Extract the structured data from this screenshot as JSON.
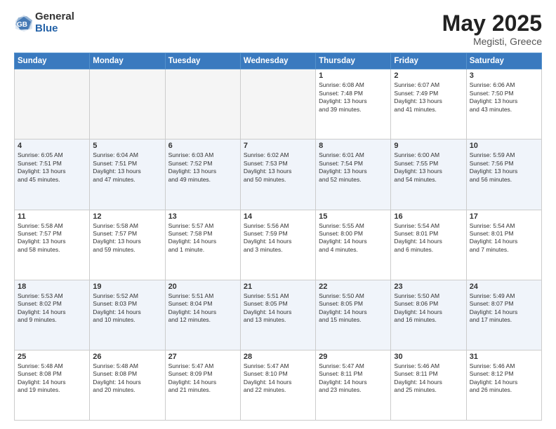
{
  "logo": {
    "general": "General",
    "blue": "Blue"
  },
  "title": {
    "month_year": "May 2025",
    "location": "Megisti, Greece"
  },
  "days_of_week": [
    "Sunday",
    "Monday",
    "Tuesday",
    "Wednesday",
    "Thursday",
    "Friday",
    "Saturday"
  ],
  "weeks": [
    [
      {
        "day": "",
        "info": ""
      },
      {
        "day": "",
        "info": ""
      },
      {
        "day": "",
        "info": ""
      },
      {
        "day": "",
        "info": ""
      },
      {
        "day": "1",
        "info": "Sunrise: 6:08 AM\nSunset: 7:48 PM\nDaylight: 13 hours\nand 39 minutes."
      },
      {
        "day": "2",
        "info": "Sunrise: 6:07 AM\nSunset: 7:49 PM\nDaylight: 13 hours\nand 41 minutes."
      },
      {
        "day": "3",
        "info": "Sunrise: 6:06 AM\nSunset: 7:50 PM\nDaylight: 13 hours\nand 43 minutes."
      }
    ],
    [
      {
        "day": "4",
        "info": "Sunrise: 6:05 AM\nSunset: 7:51 PM\nDaylight: 13 hours\nand 45 minutes."
      },
      {
        "day": "5",
        "info": "Sunrise: 6:04 AM\nSunset: 7:51 PM\nDaylight: 13 hours\nand 47 minutes."
      },
      {
        "day": "6",
        "info": "Sunrise: 6:03 AM\nSunset: 7:52 PM\nDaylight: 13 hours\nand 49 minutes."
      },
      {
        "day": "7",
        "info": "Sunrise: 6:02 AM\nSunset: 7:53 PM\nDaylight: 13 hours\nand 50 minutes."
      },
      {
        "day": "8",
        "info": "Sunrise: 6:01 AM\nSunset: 7:54 PM\nDaylight: 13 hours\nand 52 minutes."
      },
      {
        "day": "9",
        "info": "Sunrise: 6:00 AM\nSunset: 7:55 PM\nDaylight: 13 hours\nand 54 minutes."
      },
      {
        "day": "10",
        "info": "Sunrise: 5:59 AM\nSunset: 7:56 PM\nDaylight: 13 hours\nand 56 minutes."
      }
    ],
    [
      {
        "day": "11",
        "info": "Sunrise: 5:58 AM\nSunset: 7:57 PM\nDaylight: 13 hours\nand 58 minutes."
      },
      {
        "day": "12",
        "info": "Sunrise: 5:58 AM\nSunset: 7:57 PM\nDaylight: 13 hours\nand 59 minutes."
      },
      {
        "day": "13",
        "info": "Sunrise: 5:57 AM\nSunset: 7:58 PM\nDaylight: 14 hours\nand 1 minute."
      },
      {
        "day": "14",
        "info": "Sunrise: 5:56 AM\nSunset: 7:59 PM\nDaylight: 14 hours\nand 3 minutes."
      },
      {
        "day": "15",
        "info": "Sunrise: 5:55 AM\nSunset: 8:00 PM\nDaylight: 14 hours\nand 4 minutes."
      },
      {
        "day": "16",
        "info": "Sunrise: 5:54 AM\nSunset: 8:01 PM\nDaylight: 14 hours\nand 6 minutes."
      },
      {
        "day": "17",
        "info": "Sunrise: 5:54 AM\nSunset: 8:01 PM\nDaylight: 14 hours\nand 7 minutes."
      }
    ],
    [
      {
        "day": "18",
        "info": "Sunrise: 5:53 AM\nSunset: 8:02 PM\nDaylight: 14 hours\nand 9 minutes."
      },
      {
        "day": "19",
        "info": "Sunrise: 5:52 AM\nSunset: 8:03 PM\nDaylight: 14 hours\nand 10 minutes."
      },
      {
        "day": "20",
        "info": "Sunrise: 5:51 AM\nSunset: 8:04 PM\nDaylight: 14 hours\nand 12 minutes."
      },
      {
        "day": "21",
        "info": "Sunrise: 5:51 AM\nSunset: 8:05 PM\nDaylight: 14 hours\nand 13 minutes."
      },
      {
        "day": "22",
        "info": "Sunrise: 5:50 AM\nSunset: 8:05 PM\nDaylight: 14 hours\nand 15 minutes."
      },
      {
        "day": "23",
        "info": "Sunrise: 5:50 AM\nSunset: 8:06 PM\nDaylight: 14 hours\nand 16 minutes."
      },
      {
        "day": "24",
        "info": "Sunrise: 5:49 AM\nSunset: 8:07 PM\nDaylight: 14 hours\nand 17 minutes."
      }
    ],
    [
      {
        "day": "25",
        "info": "Sunrise: 5:48 AM\nSunset: 8:08 PM\nDaylight: 14 hours\nand 19 minutes."
      },
      {
        "day": "26",
        "info": "Sunrise: 5:48 AM\nSunset: 8:08 PM\nDaylight: 14 hours\nand 20 minutes."
      },
      {
        "day": "27",
        "info": "Sunrise: 5:47 AM\nSunset: 8:09 PM\nDaylight: 14 hours\nand 21 minutes."
      },
      {
        "day": "28",
        "info": "Sunrise: 5:47 AM\nSunset: 8:10 PM\nDaylight: 14 hours\nand 22 minutes."
      },
      {
        "day": "29",
        "info": "Sunrise: 5:47 AM\nSunset: 8:11 PM\nDaylight: 14 hours\nand 23 minutes."
      },
      {
        "day": "30",
        "info": "Sunrise: 5:46 AM\nSunset: 8:11 PM\nDaylight: 14 hours\nand 25 minutes."
      },
      {
        "day": "31",
        "info": "Sunrise: 5:46 AM\nSunset: 8:12 PM\nDaylight: 14 hours\nand 26 minutes."
      }
    ]
  ]
}
